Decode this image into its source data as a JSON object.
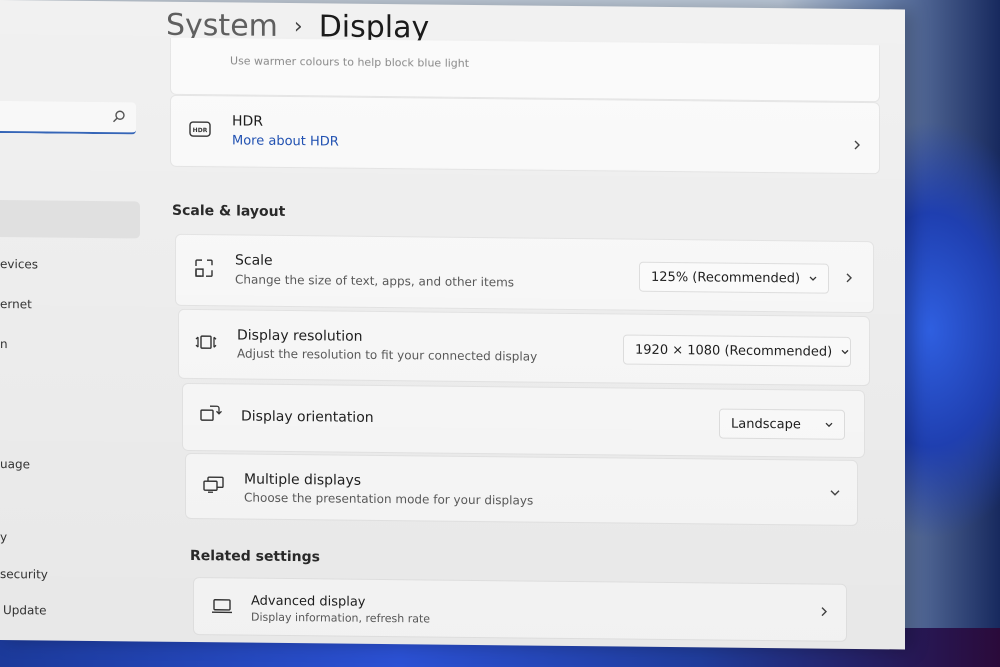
{
  "breadcrumb": {
    "root": "System",
    "current": "Display"
  },
  "night_light": {
    "subtitle_partial": "Use warmer colours to help block blue light"
  },
  "hdr": {
    "icon_text": "HDR",
    "label": "HDR",
    "link": "More about HDR"
  },
  "sections": {
    "scale_layout": "Scale & layout",
    "related": "Related settings"
  },
  "scale": {
    "label": "Scale",
    "description": "Change the size of text, apps, and other items",
    "value": "125% (Recommended)"
  },
  "resolution": {
    "label": "Display resolution",
    "description": "Adjust the resolution to fit your connected display",
    "value": "1920 × 1080 (Recommended)"
  },
  "orientation": {
    "label": "Display orientation",
    "value": "Landscape"
  },
  "multiple_displays": {
    "label": "Multiple displays",
    "description": "Choose the presentation mode for your displays"
  },
  "advanced_display": {
    "label": "Advanced display",
    "description": "Display information, refresh rate"
  },
  "sidebar": {
    "items": [
      "evices",
      "ernet",
      "n",
      "uage",
      "y",
      "security",
      "Update"
    ]
  },
  "colors": {
    "accent": "#3566b8",
    "link": "#2152b3",
    "background": "#f1f1f1",
    "card": "#fbfbfb"
  }
}
